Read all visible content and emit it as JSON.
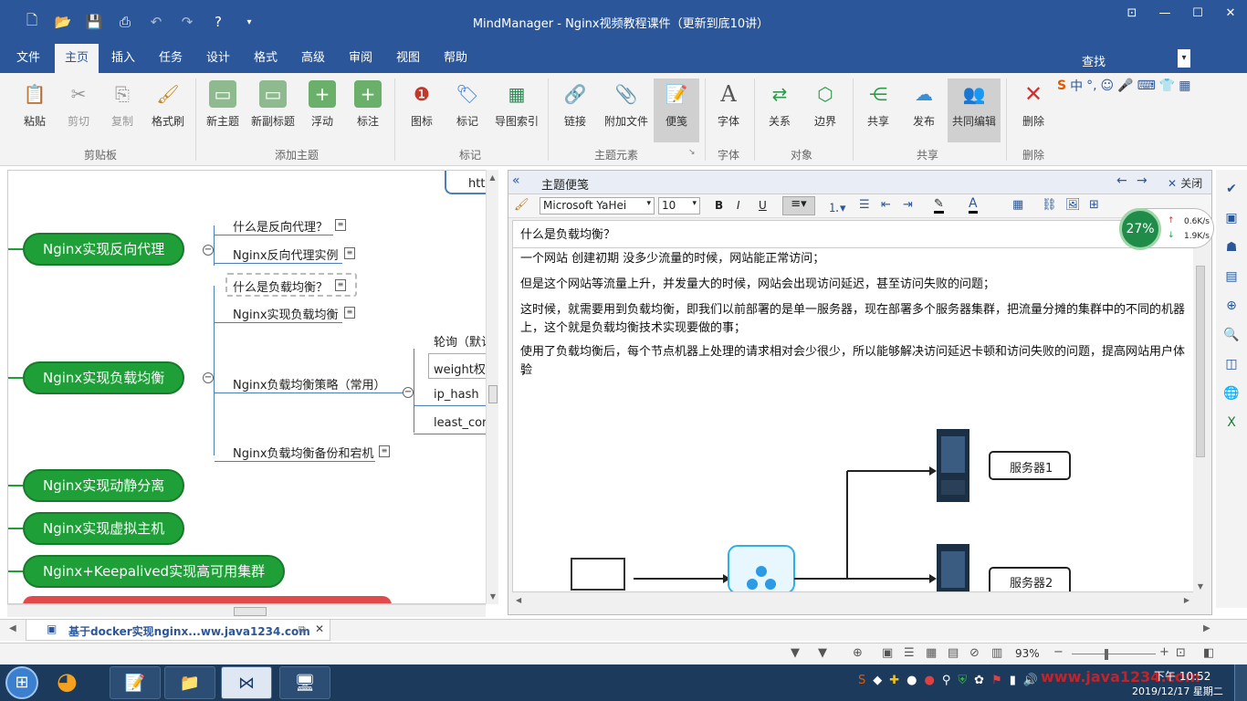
{
  "window": {
    "title": "MindManager - Nginx视频教程课件（更新到底10讲）"
  },
  "menu": {
    "tabs": [
      "文件",
      "主页",
      "插入",
      "任务",
      "设计",
      "格式",
      "高级",
      "审阅",
      "视图",
      "帮助"
    ],
    "active": "主页",
    "find_label": "查找"
  },
  "ribbon": {
    "buttons": {
      "paste": "粘贴",
      "cut": "剪切",
      "copy": "复制",
      "format_painter": "格式刷",
      "new_topic": "新主题",
      "new_subtopic": "新副标题",
      "floating": "浮动",
      "callout": "标注",
      "icon": "图标",
      "tag": "标记",
      "map_index": "导图索引",
      "link": "链接",
      "attach": "附加文件",
      "notes": "便笺",
      "font": "字体",
      "relationship": "关系",
      "boundary": "边界",
      "share": "共享",
      "publish": "发布",
      "coedit": "共同编辑",
      "delete": "删除"
    },
    "groups": {
      "clipboard": "剪贴板",
      "add_topic": "添加主题",
      "markers": "标记",
      "topic_elements": "主题元素",
      "font": "字体",
      "objects": "对象",
      "share": "共享",
      "delete": "删除"
    }
  },
  "map": {
    "top_partial_text": "htt",
    "main_nodes": [
      "Nginx实现反向代理",
      "Nginx实现负载均衡",
      "Nginx实现动静分离",
      "Nginx实现虚拟主机",
      "Nginx+Keepalived实现高可用集群"
    ],
    "reverse_proxy_children": [
      "什么是反向代理？",
      "Nginx反向代理实例"
    ],
    "lb_children": [
      "什么是负载均衡？",
      "Nginx实现负载均衡",
      "Nginx负载均衡策略（常用）",
      "Nginx负载均衡备份和宕机"
    ],
    "strategy_children": [
      "轮询（默认",
      "weight权",
      "ip_hash",
      "least_con"
    ]
  },
  "notes_panel": {
    "title": "主题便笺",
    "close_label": "关闭",
    "font_name": "Microsoft YaHei",
    "font_size": "10",
    "heading": "什么是负载均衡？",
    "paragraphs": [
      "一个网站 创建初期 没多少流量的时候，网站能正常访问；",
      "但是这个网站等流量上升，并发量大的时候，网站会出现访问延迟，甚至访问失败的问题；",
      "这时候，就需要用到负载均衡，即我们以前部署的是单一服务器，现在部署多个服务器集群，把流量分摊的集群中的不同的机器",
      "上，这个就是负载均衡技术实现要做的事；",
      "使用了负载均衡后，每个节点机器上处理的请求相对会少很少，所以能够解决访问延迟卡顿和访问失败的问题，提高网站用户体验",
      "；"
    ],
    "server1": "服务器1",
    "server2": "服务器2"
  },
  "net_widget": {
    "percent": "27%",
    "up": "0.6K/s",
    "down": "1.9K/s"
  },
  "doc_tab": {
    "label": "基于docker实现nginx...ww.java1234.com"
  },
  "status": {
    "zoom": "93%"
  },
  "taskbar": {
    "time": "下午 10:52",
    "date": "2019/12/17 星期二",
    "watermark": "www.java1234.com"
  },
  "colors": {
    "accent": "#2b579a",
    "node_green": "#1f9f38"
  }
}
